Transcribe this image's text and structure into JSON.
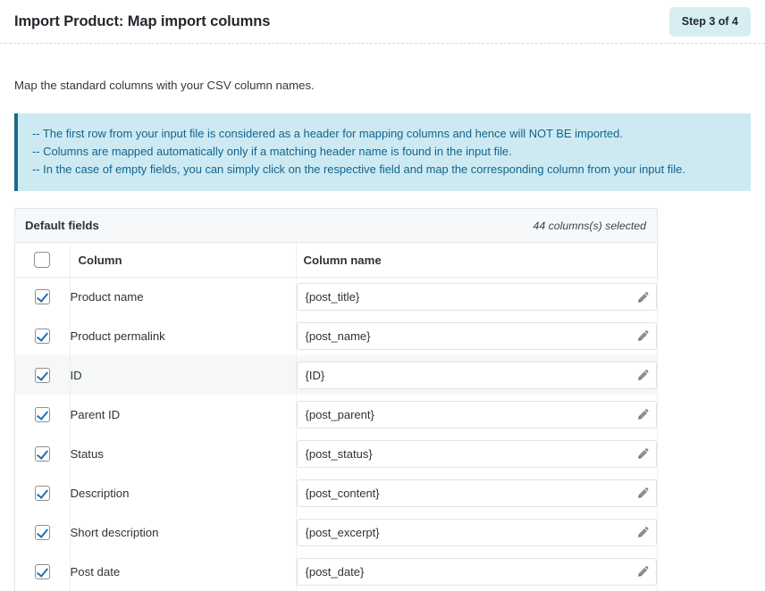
{
  "header": {
    "title": "Import Product: Map import columns",
    "step_badge": "Step 3 of 4",
    "badge_color": "#d6eef2"
  },
  "intro": {
    "text": "Map the standard columns with your CSV column names."
  },
  "notice": {
    "accent_color": "#1b6a8a",
    "background_color": "#cdeaf2",
    "text_color": "#126490",
    "lines": [
      "-- The first row from your input file is considered as a header for mapping columns and hence will NOT BE imported.",
      "-- Columns are mapped automatically only if a matching header name is found in the input file.",
      "-- In the case of empty fields, you can simply click on the respective field and map the corresponding column from your input file."
    ]
  },
  "panel": {
    "title": "Default fields",
    "selected_meta": "44 columns(s) selected",
    "columns": {
      "select_all_checked": false,
      "column_header": "Column",
      "column_name_header": "Column name"
    },
    "edit_icon": "pencil-icon",
    "accent_checkbox_color": "#2271b1",
    "rows": [
      {
        "checked": true,
        "label": "Product name",
        "value": "{post_title}",
        "highlighted": false
      },
      {
        "checked": true,
        "label": "Product permalink",
        "value": "{post_name}",
        "highlighted": false
      },
      {
        "checked": true,
        "label": "ID",
        "value": "{ID}",
        "highlighted": true
      },
      {
        "checked": true,
        "label": "Parent ID",
        "value": "{post_parent}",
        "highlighted": false
      },
      {
        "checked": true,
        "label": "Status",
        "value": "{post_status}",
        "highlighted": false
      },
      {
        "checked": true,
        "label": "Description",
        "value": "{post_content}",
        "highlighted": false
      },
      {
        "checked": true,
        "label": "Short description",
        "value": "{post_excerpt}",
        "highlighted": false
      },
      {
        "checked": true,
        "label": "Post date",
        "value": "{post_date}",
        "highlighted": false
      }
    ]
  }
}
